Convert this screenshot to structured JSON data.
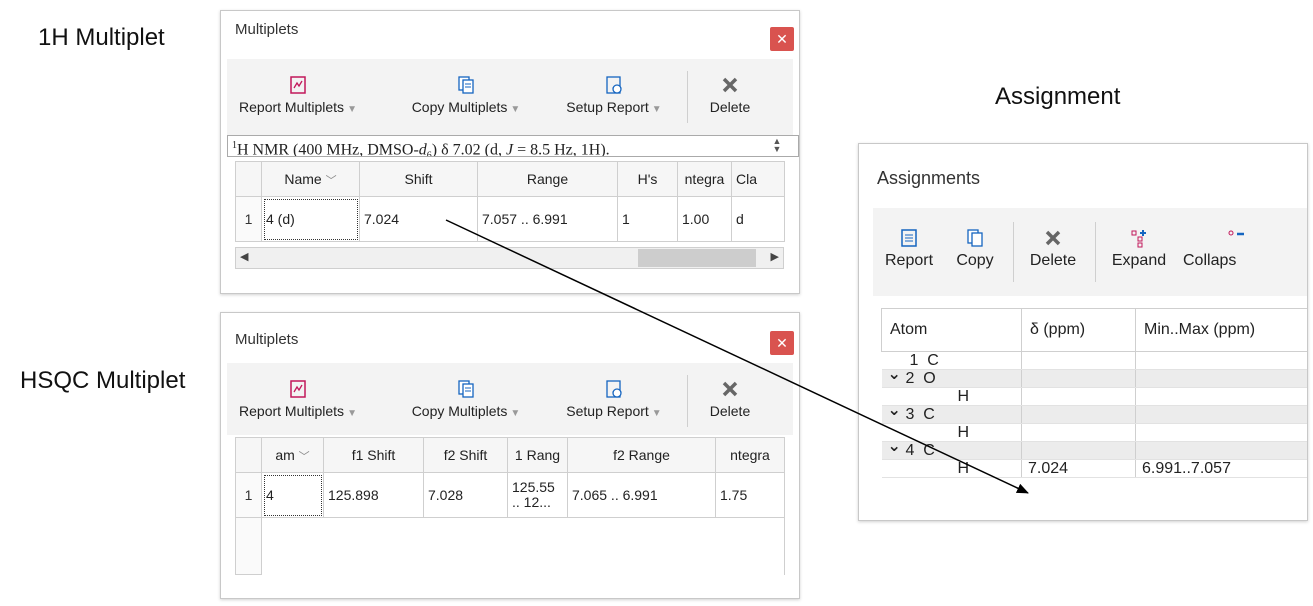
{
  "captions": {
    "h1": "1H Multiplet",
    "hsqc": "HSQC Multiplet",
    "assign": "Assignment"
  },
  "panel1": {
    "title": "Multiplets",
    "toolbar": [
      "Report Multiplets",
      "Copy Multiplets",
      "Setup Report",
      "Delete"
    ],
    "summary_parts": [
      "1",
      "H NMR (400 MHz, DMSO-",
      "d",
      "6",
      ") δ 7.02 (d, ",
      "J",
      " = 8.5 Hz, 1H)."
    ],
    "columns": [
      "Name",
      "Shift",
      "Range",
      "H's",
      "ntegra",
      "Cla"
    ],
    "rows": [
      {
        "index": "1",
        "name": "4 (d)",
        "shift": "7.024",
        "range": "7.057 .. 6.991",
        "hs": "1",
        "integral": "1.00",
        "class": "d"
      }
    ]
  },
  "panel2": {
    "title": "Multiplets",
    "toolbar": [
      "Report Multiplets",
      "Copy Multiplets",
      "Setup Report",
      "Delete"
    ],
    "columns": [
      "am",
      "f1 Shift",
      "f2 Shift",
      "1 Rang",
      "f2 Range",
      "ntegra"
    ],
    "rows": [
      {
        "index": "1",
        "name": "4",
        "f1": "125.898",
        "f2": "7.028",
        "f1range": "125.55\n.. 12...",
        "f2range": "7.065 .. 6.991",
        "integral": "1.75"
      }
    ]
  },
  "panel3": {
    "title": "Assignments",
    "toolbar": [
      "Report",
      "Copy",
      "Delete",
      "Expand",
      "Collaps"
    ],
    "columns": [
      "Atom",
      "δ (ppm)",
      "Min..Max (ppm)"
    ],
    "rows": [
      {
        "atom": "1  C",
        "shift": "",
        "range": "",
        "group": false,
        "chevron": false
      },
      {
        "atom": "2  O",
        "shift": "",
        "range": "",
        "group": true,
        "chevron": true
      },
      {
        "atom": "H",
        "shift": "",
        "range": "",
        "group": false,
        "chevron": false,
        "child": true
      },
      {
        "atom": "3  C",
        "shift": "",
        "range": "",
        "group": true,
        "chevron": true
      },
      {
        "atom": "H",
        "shift": "",
        "range": "",
        "group": false,
        "chevron": false,
        "child": true
      },
      {
        "atom": "4  C",
        "shift": "",
        "range": "",
        "group": true,
        "chevron": true
      },
      {
        "atom": "H",
        "shift": "7.024",
        "range": "6.991..7.057",
        "group": false,
        "chevron": false,
        "child": true
      }
    ]
  },
  "colors": {
    "close": "#d9534f",
    "icon_pink": "#c2185b",
    "icon_blue": "#1565c0",
    "arrow": "#000000"
  }
}
